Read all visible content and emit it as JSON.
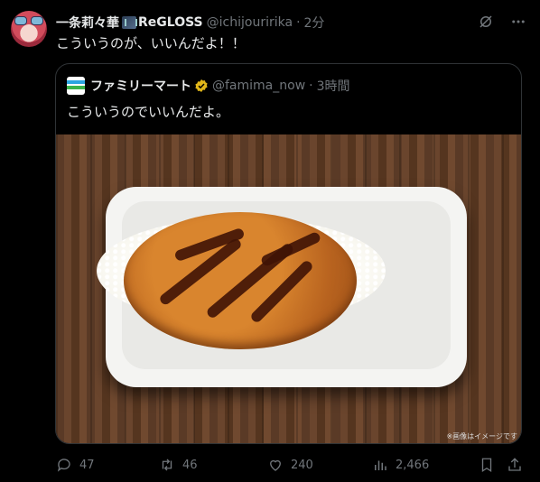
{
  "tweet": {
    "author_name": "一条莉々華",
    "author_suffix": "ReGLOSS",
    "handle": "@ichijouririka",
    "separator": "·",
    "time": "2分",
    "text": "こういうのが、いいんだよ！！"
  },
  "quote": {
    "author_name": "ファミリーマート",
    "handle": "@famima_now",
    "separator": "·",
    "time": "3時間",
    "text": "こういうのでいいんだよ。",
    "image_note": "※画像はイメージです"
  },
  "actions": {
    "replies": "47",
    "retweets": "46",
    "likes": "240",
    "views": "2,466"
  },
  "colors": {
    "verified_gold": "#e2b719",
    "text_muted": "#71767b"
  },
  "icons": [
    "grok-icon",
    "more-icon",
    "reply-icon",
    "retweet-icon",
    "like-icon",
    "views-icon",
    "bookmark-icon",
    "share-icon"
  ]
}
